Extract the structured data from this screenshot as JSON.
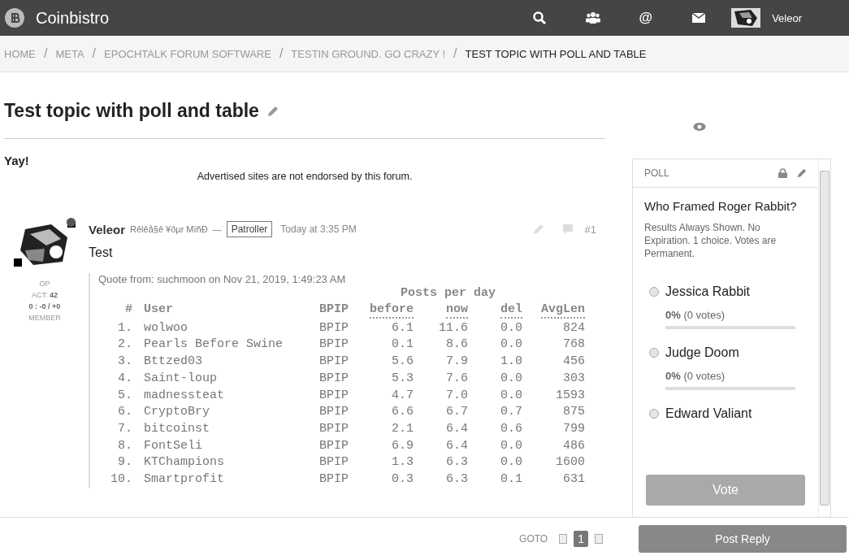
{
  "header": {
    "site_name": "Coinbistro",
    "user_name": "Veleor",
    "mentions_glyph": "@"
  },
  "breadcrumbs": [
    {
      "label": "HOME",
      "current": false
    },
    {
      "separator": "/",
      "label": "META",
      "current": false
    },
    {
      "separator": "/",
      "label": "EPOCHTALK FORUM SOFTWARE",
      "current": false
    },
    {
      "separator": "/",
      "label": "TESTIN GROUND. GO CRAZY !",
      "current": false
    },
    {
      "separator": "/",
      "label": "TEST TOPIC WITH POLL AND TABLE",
      "current": true
    }
  ],
  "topic": {
    "title": "Test topic with poll and table"
  },
  "intro": "Yay!",
  "ad_notice": "Advertised sites are not endorsed by this forum.",
  "post": {
    "author": "Veleor",
    "online": true,
    "user_title": "Rêlêå§ê ¥ðµr MïñÐ",
    "separator": "—",
    "role": "Patroller",
    "time": "Today at 3:35 PM",
    "number": "#1",
    "body": "Test",
    "op": "OP",
    "activity_label": "ACT:",
    "activity": "42",
    "trust": "0 : -0 / +0",
    "rank": "MEMBER",
    "quote": {
      "source": "Quote from: suchmoon on Nov 21, 2019, 1:49:23 AM",
      "group_heading": "Posts per day",
      "columns": [
        {
          "label": "#",
          "dotted": false
        },
        {
          "label": "User",
          "dotted": false
        },
        {
          "label": "BPIP",
          "dotted": false
        },
        {
          "label": "before",
          "dotted": true
        },
        {
          "label": "now",
          "dotted": true
        },
        {
          "label": "del",
          "dotted": true
        },
        {
          "label": "AvgLen",
          "dotted": true
        }
      ],
      "rows": [
        [
          "1.",
          "wolwoo",
          "BPIP",
          "6.1",
          "11.6",
          "0.0",
          "824"
        ],
        [
          "2.",
          "Pearls Before Swine",
          "BPIP",
          "0.1",
          "8.6",
          "0.0",
          "768"
        ],
        [
          "3.",
          "Bttzed03",
          "BPIP",
          "5.6",
          "7.9",
          "1.0",
          "456"
        ],
        [
          "4.",
          "Saint-loup",
          "BPIP",
          "5.3",
          "7.6",
          "0.0",
          "303"
        ],
        [
          "5.",
          "madnessteat",
          "BPIP",
          "4.7",
          "7.0",
          "0.0",
          "1593"
        ],
        [
          "6.",
          "CryptoBry",
          "BPIP",
          "6.6",
          "6.7",
          "0.7",
          "875"
        ],
        [
          "7.",
          "bitcoinst",
          "BPIP",
          "2.1",
          "6.4",
          "0.6",
          "799"
        ],
        [
          "8.",
          "FontSeli",
          "BPIP",
          "6.9",
          "6.4",
          "0.0",
          "486"
        ],
        [
          "9.",
          "KTChampions",
          "BPIP",
          "1.3",
          "6.3",
          "0.0",
          "1600"
        ],
        [
          "10.",
          "Smartprofit",
          "BPIP",
          "0.3",
          "6.3",
          "0.1",
          "631"
        ]
      ]
    }
  },
  "poll": {
    "label": "POLL",
    "question": "Who Framed Roger Rabbit?",
    "rules": "Results Always Shown. No Expiration. 1 choice. Votes are Permanent.",
    "options": [
      {
        "label": "Jessica Rabbit",
        "selected": false,
        "result": "**0%** (0 votes)",
        "level": 0
      },
      {
        "label": "Judge Doom",
        "selected": false,
        "result": "**0%** (0 votes)",
        "level": 0
      },
      {
        "label": "Edward Valiant",
        "selected": false
      }
    ],
    "vote_button": {
      "label": "Vote",
      "disabled": true
    }
  },
  "footer": {
    "goto": "GOTO",
    "pages": [
      {
        "label": "1",
        "selected": true
      }
    ],
    "reply_button": "Post Reply"
  }
}
